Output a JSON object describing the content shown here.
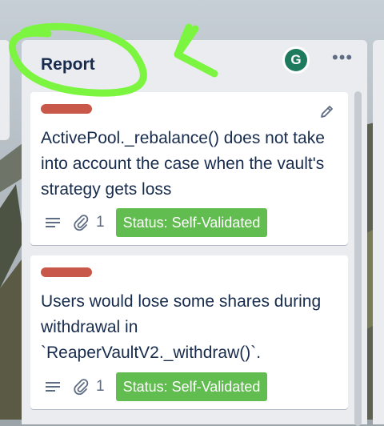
{
  "list": {
    "title": "Report",
    "avatar_letter": "G",
    "more_icon": "ellipsis-icon"
  },
  "colors": {
    "label": "#c8584a",
    "status": "#61bd4f",
    "annotation": "#7cf540"
  },
  "cards": [
    {
      "label_color": "#c8584a",
      "title": "ActivePool._rebalance() does not take into account the case when the vault's strategy gets loss",
      "attachment_count": "1",
      "status": "Status: Self-Validated"
    },
    {
      "label_color": "#c8584a",
      "title": "Users would lose some shares during withdrawal in `ReaperVaultV2._withdraw()`.",
      "attachment_count": "1",
      "status": "Status: Self-Validated"
    }
  ]
}
